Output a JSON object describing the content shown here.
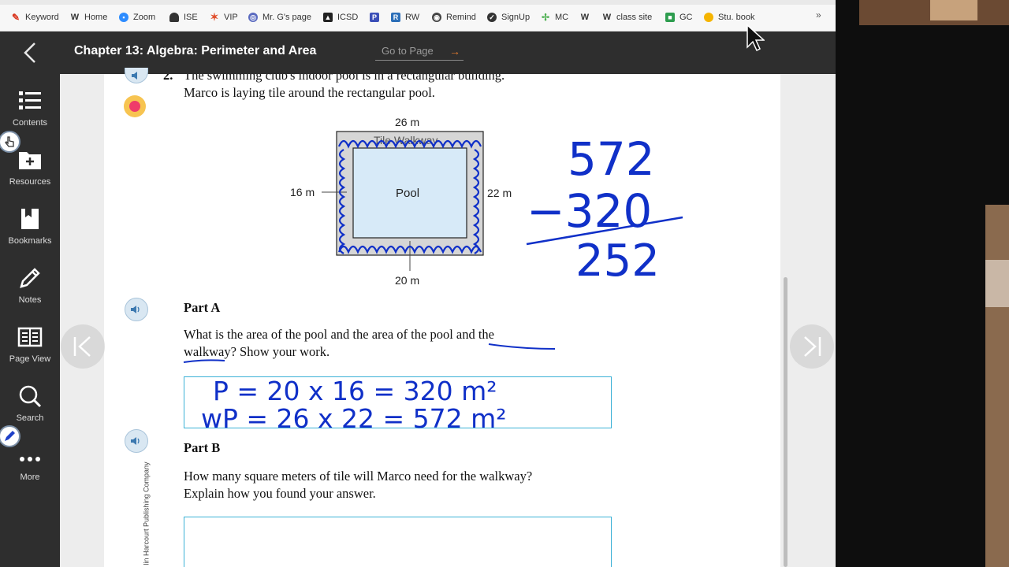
{
  "bookmarks": [
    {
      "label": "Keyword",
      "icon": "pen-icon",
      "color": "#d9361f"
    },
    {
      "label": "Home",
      "icon": "w-icon",
      "color": "#333333"
    },
    {
      "label": "Zoom",
      "icon": "camera-icon",
      "color": "#2d8cff"
    },
    {
      "label": "ISE",
      "icon": "hat-icon",
      "color": "#333333"
    },
    {
      "label": "VIP",
      "icon": "star-icon",
      "color": "#e04e2b"
    },
    {
      "label": "Mr. G's page",
      "icon": "globe-icon",
      "color": "#5b6bc0"
    },
    {
      "label": "ICSD",
      "icon": "flag-icon",
      "color": "#222222"
    },
    {
      "label": "",
      "icon": "p-icon",
      "color": "#3b4fb8"
    },
    {
      "label": "RW",
      "icon": "r-icon",
      "color": "#2c6fb8"
    },
    {
      "label": "Remind",
      "icon": "remind-icon",
      "color": "#333333"
    },
    {
      "label": "SignUp",
      "icon": "signup-icon",
      "color": "#333333"
    },
    {
      "label": "MC",
      "icon": "pinwheel-icon",
      "color": "#4caf50"
    },
    {
      "label": "",
      "icon": "w-icon",
      "color": "#333333"
    },
    {
      "label": "class site",
      "icon": "w-icon",
      "color": "#333333"
    },
    {
      "label": "GC",
      "icon": "classroom-icon",
      "color": "#2e9d4f"
    },
    {
      "label": "Stu. book",
      "icon": "circle-icon",
      "color": "#f5b400"
    }
  ],
  "header": {
    "title": "Chapter 13: Algebra: Perimeter and Area",
    "goto_label": "Go to Page",
    "goto_arrow": "→"
  },
  "sidebar": {
    "items": [
      {
        "label": "Contents",
        "icon": "list-icon"
      },
      {
        "label": "Resources",
        "icon": "folder-plus-icon"
      },
      {
        "label": "Bookmarks",
        "icon": "bookmark-icon"
      },
      {
        "label": "Notes",
        "icon": "pencil-icon"
      },
      {
        "label": "Page View",
        "icon": "page-view-icon"
      },
      {
        "label": "Search",
        "icon": "search-icon"
      },
      {
        "label": "More",
        "icon": "more-icon"
      }
    ]
  },
  "problem": {
    "number": "2.",
    "line1": "The swimming club's indoor pool is in a rectangular building.",
    "line2": "Marco is laying tile around the rectangular pool."
  },
  "figure": {
    "top_label": "26 m",
    "walkway_label": "Tile Walkway",
    "pool_label": "Pool",
    "left_label": "16 m",
    "right_label": "22 m",
    "bottom_label": "20 m"
  },
  "partA": {
    "title": "Part A",
    "q1": "What  is the area of the pool and the area of the pool and the",
    "q2": "walkway? Show your work."
  },
  "partB": {
    "title": "Part B",
    "q1": "How many square meters of tile will Marco need for the walkway?",
    "q2": "Explain how you found your answer."
  },
  "handwriting": {
    "sub_top": "572",
    "sub_minus": "−320",
    "sub_result": "252",
    "ans1": "P = 20 x 16 = 320 m²",
    "ans2": "wP = 26 x 22 = 572 m²"
  },
  "copyright": "lin Harcourt Publishing Company"
}
